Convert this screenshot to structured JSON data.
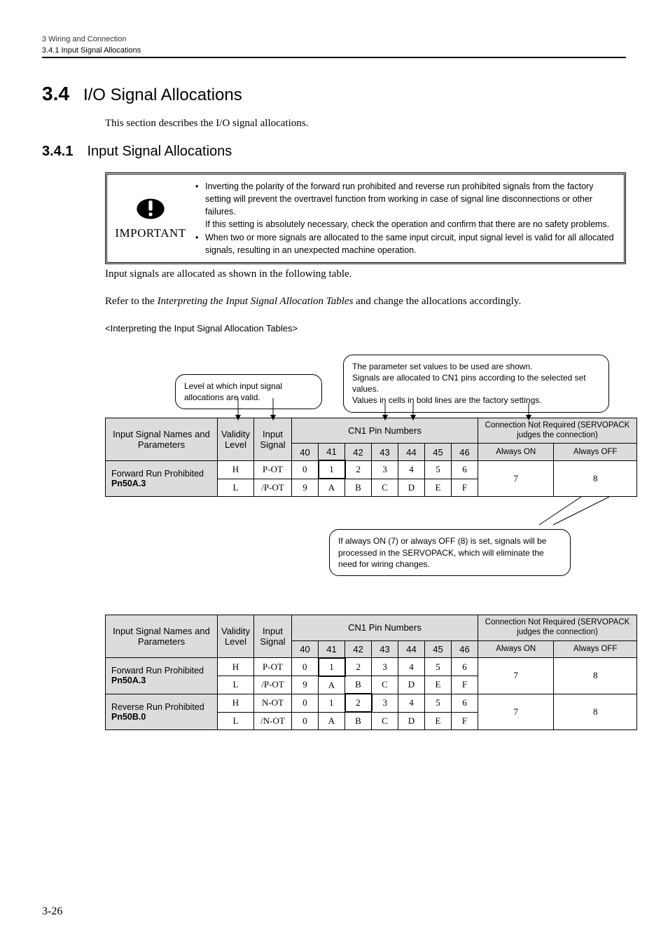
{
  "header": {
    "chapter": "3  Wiring and Connection",
    "sub": "3.4.1  Input Signal Allocations"
  },
  "section": {
    "num": "3.4",
    "title": "I/O Signal Allocations"
  },
  "intro": "This section describes the I/O signal allocations.",
  "subsection": {
    "num": "3.4.1",
    "title": "Input Signal Allocations"
  },
  "important": {
    "label": "IMPORTANT",
    "b1a": "Inverting the polarity of the forward run prohibited and reverse run prohibited signals from the factory setting will prevent the overtravel function from working in case of signal line disconnections or other failures.",
    "b1b": "If this setting is absolutely necessary, check the operation and confirm that there are no safety problems.",
    "b2": "When two or more signals are allocated to the same input circuit, input signal level is valid for all allocated signals, resulting in an unexpected machine operation."
  },
  "caption": "Input signals are allocated as shown in the following table.",
  "refer_a": "Refer to the ",
  "refer_i": "Interpreting the Input Signal Allocation Tables",
  "refer_b": " and change the allocations accordingly.",
  "interp": "<Interpreting the Input Signal Allocation Tables>",
  "bubble_left": "Level at which input signal allocations are valid.",
  "bubble_right_a": "The parameter set values to be used are shown.",
  "bubble_right_b": "Signals are allocated to CN1 pins according to the selected set values.",
  "bubble_right_c": "Values in cells in bold lines are the factory settings.",
  "bubble_bottom": "If always ON (7) or always OFF (8) is set, signals will be processed in the SERVOPACK, which will eliminate the need for wiring changes.",
  "thead": {
    "c1": "Input Signal Names and Parameters",
    "c2": "Validity Level",
    "c3": "Input Signal",
    "c4": "CN1 Pin Numbers",
    "c5a": "Connection Not Required (SERVOPACK judges the connection)",
    "c5b": "Connection Not Required\n(SERVOPACK judges the connection)",
    "p40": "40",
    "p41": "41",
    "p42": "42",
    "p43": "43",
    "p44": "44",
    "p45": "45",
    "p46": "46",
    "aon": "Always ON",
    "aoff": "Always OFF"
  },
  "rows": {
    "fwd": {
      "name": "Forward Run Prohibited",
      "param": "Pn50A.3",
      "H": {
        "sig": "P-OT",
        "v": [
          "0",
          "1",
          "2",
          "3",
          "4",
          "5",
          "6"
        ]
      },
      "L": {
        "sig": "/P-OT",
        "v": [
          "9",
          "A",
          "B",
          "C",
          "D",
          "E",
          "F"
        ]
      },
      "aon": "7",
      "aoff": "8"
    },
    "rev": {
      "name": "Reverse Run Prohibited",
      "param": "Pn50B.0",
      "H": {
        "sig": "N-OT",
        "v": [
          "0",
          "1",
          "2",
          "3",
          "4",
          "5",
          "6"
        ]
      },
      "L": {
        "sig": "/N-OT",
        "v": [
          "0",
          "A",
          "B",
          "C",
          "D",
          "E",
          "F"
        ]
      },
      "aon": "7",
      "aoff": "8"
    }
  },
  "levels": {
    "H": "H",
    "L": "L"
  },
  "footer": "3-26"
}
